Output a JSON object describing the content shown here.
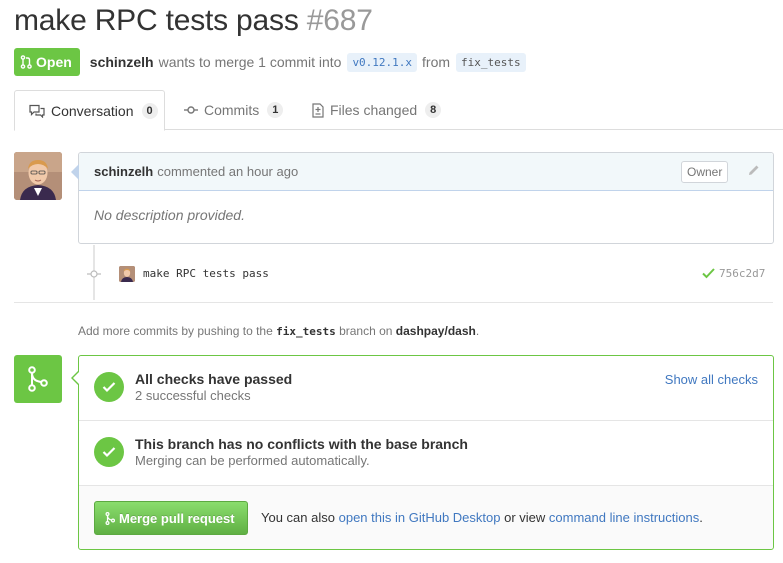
{
  "pr": {
    "title": "make RPC tests pass",
    "number": "#687",
    "state": "Open",
    "author": "schinzelh",
    "merge_text": "wants to merge 1 commit into",
    "base_branch": "v0.12.1.x",
    "from_text": "from",
    "head_branch": "fix_tests"
  },
  "tabs": [
    {
      "label": "Conversation",
      "count": "0"
    },
    {
      "label": "Commits",
      "count": "1"
    },
    {
      "label": "Files changed",
      "count": "8"
    }
  ],
  "comment": {
    "author": "schinzelh",
    "action": "commented an hour ago",
    "role": "Owner",
    "body": "No description provided."
  },
  "commit": {
    "message": "make RPC tests pass",
    "sha": "756c2d7"
  },
  "hint": {
    "prefix": "Add more commits by pushing to the",
    "branch": "fix_tests",
    "middle": "branch on",
    "owner": "dashpay",
    "slash": "/",
    "repo": "dash",
    "suffix": "."
  },
  "merge_box": {
    "checks_title": "All checks have passed",
    "checks_sub": "2 successful checks",
    "show_all": "Show all checks",
    "conflicts_title": "This branch has no conflicts with the base branch",
    "conflicts_sub": "Merging can be performed automatically.",
    "merge_button": "Merge pull request",
    "also_text": "You can also",
    "desktop_link": "open this in GitHub Desktop",
    "or_view": "or view",
    "cli_link": "command line instructions",
    "end": "."
  },
  "colors": {
    "green": "#6cc644",
    "link": "#4078c0",
    "muted": "#767676"
  }
}
